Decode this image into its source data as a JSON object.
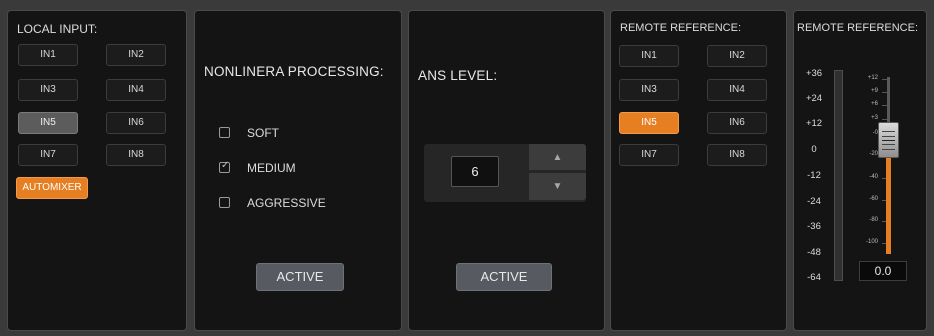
{
  "local_input": {
    "title": "LOCAL INPUT:",
    "buttons": [
      "IN1",
      "IN2",
      "IN3",
      "IN4",
      "IN5",
      "IN6",
      "IN7",
      "IN8"
    ],
    "selected": "IN5",
    "automixer_label": "AUTOMIXER"
  },
  "nonlinear": {
    "heading": "NONLINERA PROCESSING:",
    "options": [
      {
        "label": "SOFT",
        "checked": false
      },
      {
        "label": "MEDIUM",
        "checked": true
      },
      {
        "label": "AGGRESSIVE",
        "checked": false
      }
    ],
    "active_label": "ACTIVE"
  },
  "ans": {
    "heading": "ANS LEVEL:",
    "value": "6",
    "active_label": "ACTIVE"
  },
  "remote_reference_inputs": {
    "title": "REMOTE REFERENCE:",
    "buttons": [
      "IN1",
      "IN2",
      "IN3",
      "IN4",
      "IN5",
      "IN6",
      "IN7",
      "IN8"
    ],
    "selected": "IN5"
  },
  "remote_reference_level": {
    "title": "REMOTE REFERENCE:",
    "meter_scale": [
      "+36",
      "+24",
      "+12",
      "0",
      "-12",
      "-24",
      "-36",
      "-48",
      "-64"
    ],
    "fader_scale": [
      "+12",
      "+9",
      "+6",
      "+3",
      "-0",
      "-20",
      "-40",
      "-60",
      "-80",
      "-100"
    ],
    "fader_value": "0.0"
  },
  "colors": {
    "accent": "#e67e22",
    "panel_bg": "#141414",
    "frame_bg": "#3a3a3a",
    "button_selected": "#5c5c5c"
  }
}
